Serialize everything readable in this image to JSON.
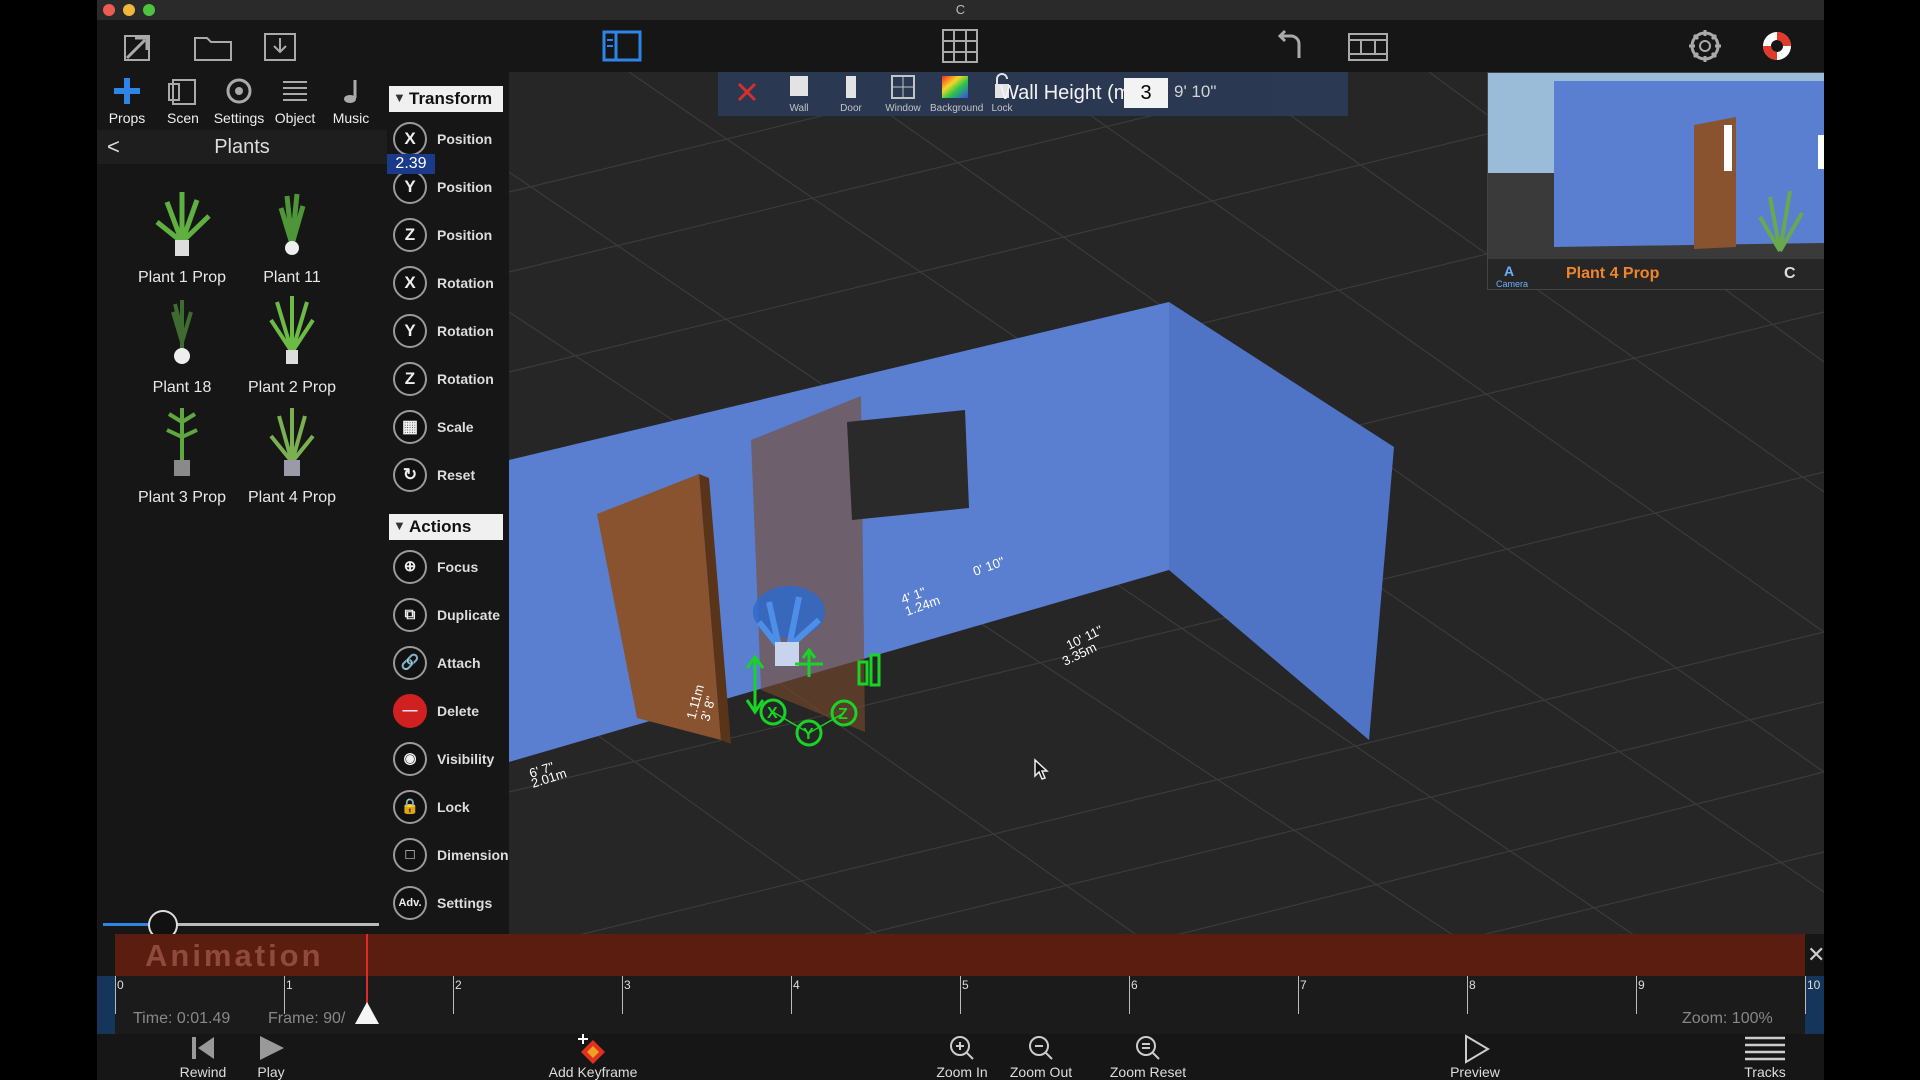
{
  "window": {
    "title": "C"
  },
  "tabs": [
    {
      "label": "Props"
    },
    {
      "label": "Scen"
    },
    {
      "label": "Settings"
    },
    {
      "label": "Object"
    },
    {
      "label": "Music"
    }
  ],
  "category": {
    "title": "Plants",
    "back": "<"
  },
  "plants": [
    {
      "label": "Plant 1 Prop"
    },
    {
      "label": "Plant 11"
    },
    {
      "label": "Plant 18"
    },
    {
      "label": "Plant 2 Prop"
    },
    {
      "label": "Plant 3 Prop"
    },
    {
      "label": "Plant 4 Prop"
    }
  ],
  "library_slider": {
    "value": 0.2
  },
  "transform": {
    "header": "Transform",
    "value_badge": "2.39",
    "items": [
      {
        "icon": "X",
        "label": "Position"
      },
      {
        "icon": "Y",
        "label": "Position"
      },
      {
        "icon": "Z",
        "label": "Position"
      },
      {
        "icon": "X",
        "label": "Rotation"
      },
      {
        "icon": "Y",
        "label": "Rotation"
      },
      {
        "icon": "Z",
        "label": "Rotation"
      },
      {
        "icon": "",
        "label": "Scale"
      },
      {
        "icon": "",
        "label": "Reset"
      }
    ]
  },
  "actions": {
    "header": "Actions",
    "items": [
      {
        "label": "Focus"
      },
      {
        "label": "Duplicate"
      },
      {
        "label": "Attach"
      },
      {
        "label": "Delete"
      },
      {
        "label": "Visibility"
      },
      {
        "label": "Lock"
      },
      {
        "label": "Dimension"
      },
      {
        "label": "Settings",
        "icon_text": "Adv."
      }
    ]
  },
  "floatbar": {
    "items": [
      {
        "label": ""
      },
      {
        "label": "Wall"
      },
      {
        "label": "Door"
      },
      {
        "label": "Window"
      },
      {
        "label": "Background"
      },
      {
        "label": "Lock"
      }
    ],
    "wall_height_label": "Wall Height (m):",
    "wall_height_value": "3",
    "wall_height_feet": "9' 10\""
  },
  "dimensions": [
    {
      "text": "6' 7\""
    },
    {
      "text": "2.01m"
    },
    {
      "text": "3' 8\""
    },
    {
      "text": "1.11m"
    },
    {
      "text": "4' 1\""
    },
    {
      "text": "1.24m"
    },
    {
      "text": "0' 10\""
    },
    {
      "text": "10' 11\""
    },
    {
      "text": "3.35m"
    }
  ],
  "preview": {
    "title": "Plant 4 Prop",
    "camera_label": "Camera",
    "camera_letter": "A",
    "right_label": "C"
  },
  "animation": {
    "title": "Animation",
    "ticks": [
      "0",
      "1",
      "2",
      "3",
      "4",
      "5",
      "6",
      "7",
      "8",
      "9",
      "10"
    ],
    "time": "Time: 0:01.49",
    "frame": "Frame: 90/",
    "zoom": "Zoom: 100%",
    "controls": {
      "rewind": "Rewind",
      "play": "Play",
      "add_keyframe": "Add Keyframe",
      "zoom_in": "Zoom In",
      "zoom_out": "Zoom Out",
      "zoom_reset": "Zoom Reset",
      "preview": "Preview",
      "tracks": "Tracks"
    }
  },
  "colors": {
    "accent": "#2f84e8",
    "wall": "#5a7fd0",
    "door": "#8a5330",
    "timeline": "#5a1d10",
    "preview_title": "#f0862a"
  }
}
